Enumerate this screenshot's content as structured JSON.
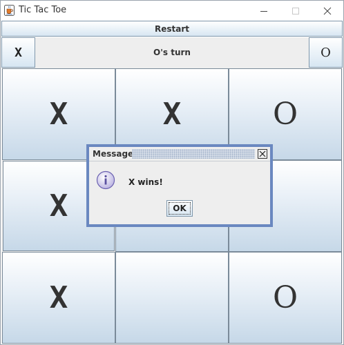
{
  "window": {
    "title": "Tic Tac Toe",
    "app_icon": "java-cup-icon",
    "controls": [
      "minimize-icon",
      "maximize-icon",
      "close-icon"
    ]
  },
  "toolbar": {
    "restart_label": "Restart"
  },
  "status": {
    "player_x": "X",
    "turn_text": "O's turn",
    "player_o": "O"
  },
  "board": {
    "cells": [
      "X",
      "X",
      "O",
      "X",
      "",
      "",
      "X",
      "",
      "O"
    ]
  },
  "dialog": {
    "title": "Message",
    "message": "X wins!",
    "ok_label": "OK",
    "icon": "info-icon"
  },
  "colors": {
    "dialog_border": "#6a88c0",
    "button_gradient_top": "#ffffff",
    "button_gradient_bottom": "#c6d8e8"
  }
}
